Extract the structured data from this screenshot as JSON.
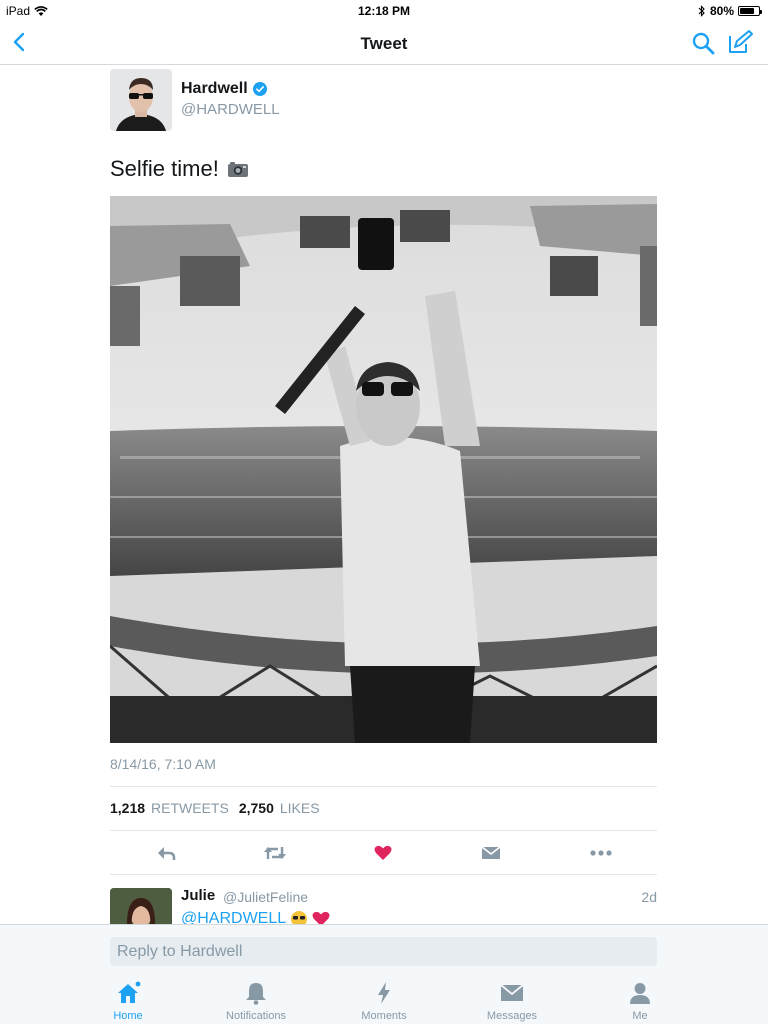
{
  "status": {
    "device": "iPad",
    "time": "12:18 PM",
    "battery": "80%",
    "battery_level": 0.8
  },
  "nav": {
    "title": "Tweet"
  },
  "tweet": {
    "author_name": "Hardwell",
    "author_handle": "@HARDWELL",
    "text": "Selfie time!",
    "timestamp": "8/14/16, 7:10 AM",
    "retweets_count": "1,218",
    "retweets_label": "RETWEETS",
    "likes_count": "2,750",
    "likes_label": "LIKES"
  },
  "reply_preview": {
    "name": "Julie",
    "handle": "@JulietFeline",
    "time": "2d",
    "text": "@HARDWELL"
  },
  "reply_box": {
    "placeholder": "Reply to Hardwell"
  },
  "tabs": [
    {
      "label": "Home",
      "icon": "home-icon",
      "active": true
    },
    {
      "label": "Notifications",
      "icon": "bell-icon",
      "active": false
    },
    {
      "label": "Moments",
      "icon": "lightning-icon",
      "active": false
    },
    {
      "label": "Messages",
      "icon": "envelope-icon",
      "active": false
    },
    {
      "label": "Me",
      "icon": "person-icon",
      "active": false
    }
  ],
  "colors": {
    "accent": "#1da1f2",
    "like": "#e0245e",
    "muted": "#8899a6",
    "text": "#14171a"
  }
}
